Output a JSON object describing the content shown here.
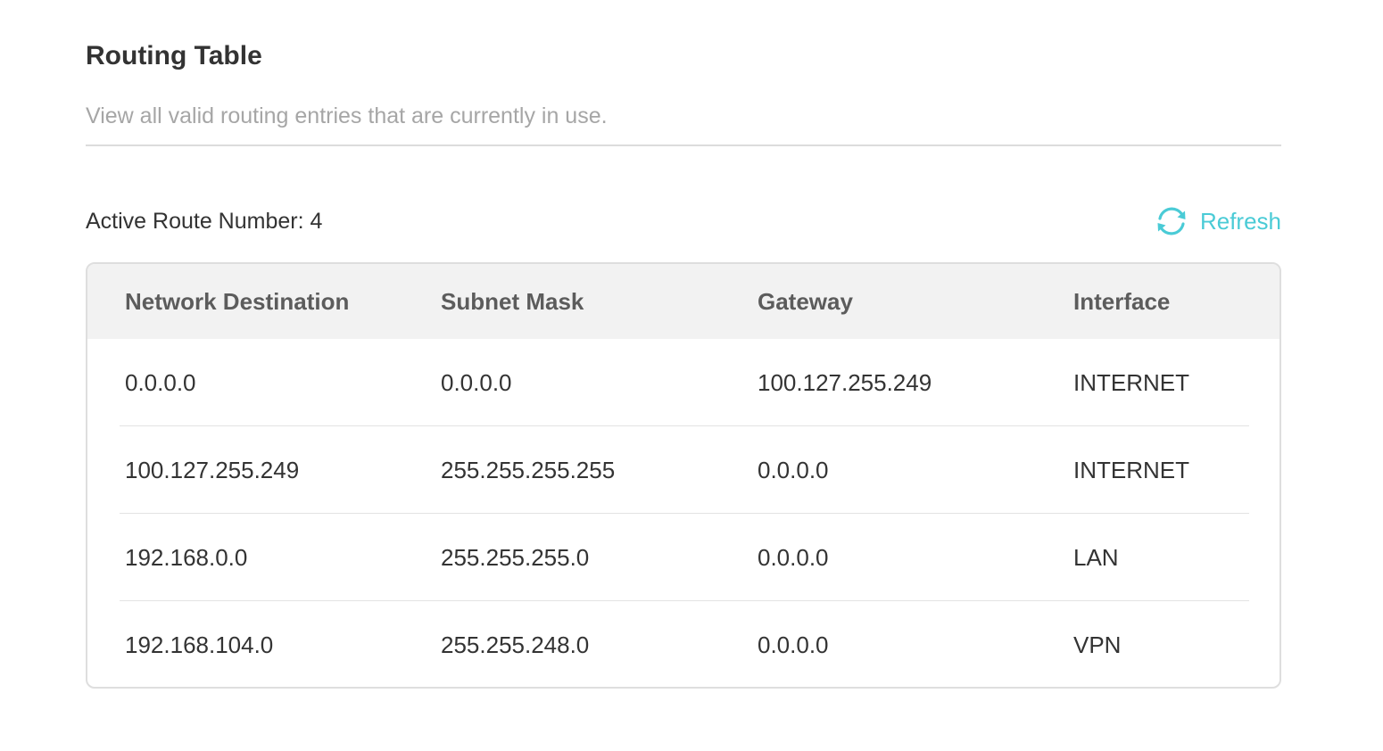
{
  "header": {
    "title": "Routing Table",
    "description": "View all valid routing entries that are currently in use."
  },
  "toolbar": {
    "route_count_label": "Active Route Number: 4",
    "refresh_label": "Refresh",
    "refresh_icon": "refresh-icon",
    "accent_color": "#4acbd6"
  },
  "table": {
    "columns": [
      "Network Destination",
      "Subnet Mask",
      "Gateway",
      "Interface"
    ],
    "rows": [
      [
        "0.0.0.0",
        "0.0.0.0",
        "100.127.255.249",
        "INTERNET"
      ],
      [
        "100.127.255.249",
        "255.255.255.255",
        "0.0.0.0",
        "INTERNET"
      ],
      [
        "192.168.0.0",
        "255.255.255.0",
        "0.0.0.0",
        "LAN"
      ],
      [
        "192.168.104.0",
        "255.255.248.0",
        "0.0.0.0",
        "VPN"
      ]
    ]
  }
}
